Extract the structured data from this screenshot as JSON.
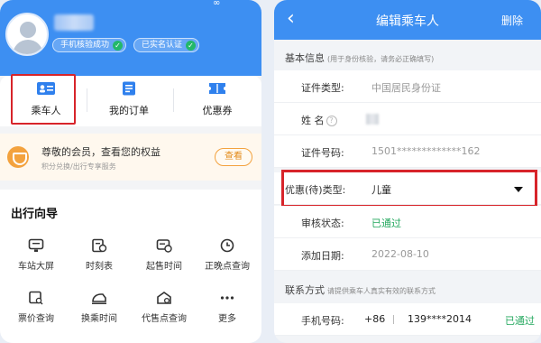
{
  "colors": {
    "primary": "#3d8ff2",
    "highlight": "#d7242a",
    "success": "#23a85e",
    "member": "#f3a23e"
  },
  "left": {
    "badges": {
      "phone_verified": "手机核验成功",
      "realname_verified": "已实名认证"
    },
    "quick_actions": [
      {
        "label": "乘车人",
        "icon": "passenger-card-icon"
      },
      {
        "label": "我的订单",
        "icon": "order-document-icon"
      },
      {
        "label": "优惠券",
        "icon": "coupon-icon"
      }
    ],
    "member": {
      "title": "尊敬的会员，查看您的权益",
      "subtitle": "积分兑换/出行专享服务",
      "view_label": "查看"
    },
    "guide": {
      "title": "出行向导",
      "items": [
        {
          "label": "车站大屏",
          "icon": "station-screen-icon"
        },
        {
          "label": "时刻表",
          "icon": "timetable-icon"
        },
        {
          "label": "起售时间",
          "icon": "sale-time-icon"
        },
        {
          "label": "正晚点查询",
          "icon": "clock-icon"
        },
        {
          "label": "票价查询",
          "icon": "fare-query-icon"
        },
        {
          "label": "换乘时间",
          "icon": "transfer-train-icon"
        },
        {
          "label": "代售点查询",
          "icon": "agency-house-icon"
        },
        {
          "label": "更多",
          "icon": "more-dots-icon"
        }
      ]
    }
  },
  "right": {
    "nav": {
      "back": "‹",
      "title": "编辑乘车人",
      "delete": "删除"
    },
    "basic": {
      "title": "基本信息",
      "note": "(用于身份核验，请务必正确填写)",
      "rows": {
        "id_type": {
          "label": "证件类型:",
          "value": "中国居民身份证"
        },
        "name": {
          "label": "姓 名"
        },
        "id_number": {
          "label": "证件号码:",
          "value": "1501*************162"
        },
        "discount_type": {
          "label": "优惠(待)类型:",
          "value": "儿童"
        },
        "review_status": {
          "label": "审核状态:",
          "value": "已通过"
        },
        "added_date": {
          "label": "添加日期:",
          "value": "2022-08-10"
        }
      }
    },
    "contact": {
      "title": "联系方式",
      "note": "请提供乘车人真实有效的联系方式",
      "phone": {
        "label": "手机号码:",
        "prefix": "+86",
        "value": "139****2014",
        "status": "已通过"
      }
    }
  }
}
